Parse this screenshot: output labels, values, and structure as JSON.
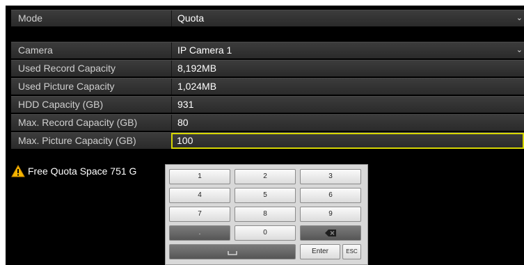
{
  "mode": {
    "label": "Mode",
    "value": "Quota"
  },
  "fields": [
    {
      "label": "Camera",
      "value": "IP Camera 1"
    },
    {
      "label": "Used Record Capacity",
      "value": "8,192MB"
    },
    {
      "label": "Used Picture Capacity",
      "value": "1,024MB"
    },
    {
      "label": "HDD Capacity (GB)",
      "value": "931"
    },
    {
      "label": "Max. Record Capacity (GB)",
      "value": "80"
    },
    {
      "label": "Max. Picture Capacity (GB)",
      "value": "100"
    }
  ],
  "warning": {
    "text": "Free Quota Space 751 G",
    "icon": "warning-icon",
    "color": "#f5b400"
  },
  "keypad": {
    "keys": [
      "1",
      "2",
      "3",
      "4",
      "5",
      "6",
      "7",
      "8",
      "9",
      ".",
      "0",
      "⌫",
      "␣",
      "Enter",
      "ESC"
    ]
  },
  "colors": {
    "active_border": "#d7d700",
    "panel": "#000000"
  }
}
